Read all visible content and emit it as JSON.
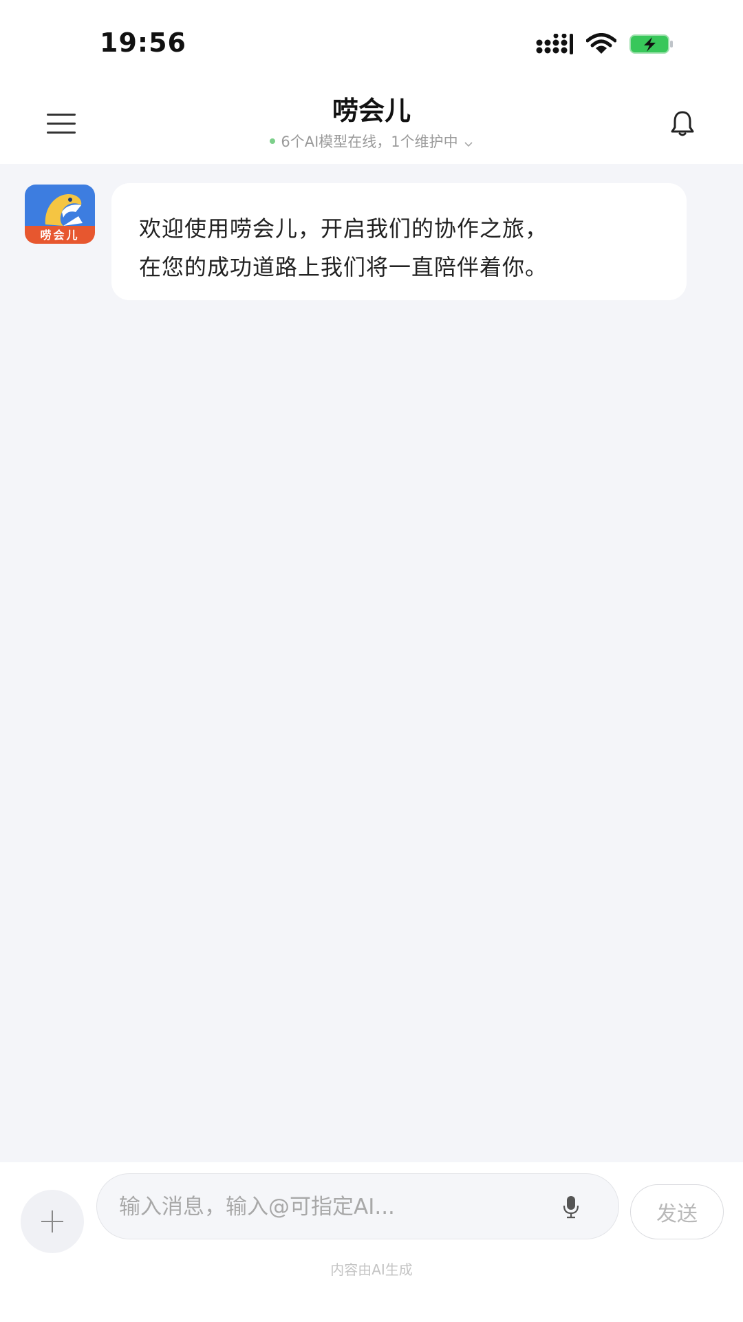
{
  "status_bar": {
    "time": "19:56"
  },
  "header": {
    "title": "唠会儿",
    "status_text": "6个AI模型在线，1个维护中",
    "menu_icon": "hamburger-menu-icon",
    "bell_icon": "bell-icon"
  },
  "chat": {
    "messages": [
      {
        "sender_avatar_label": "唠会儿",
        "lines": [
          "欢迎使用唠会儿，开启我们的协作之旅，",
          "在您的成功道路上我们将一直陪伴着你。"
        ]
      }
    ]
  },
  "input_bar": {
    "placeholder": "输入消息，输入@可指定AI...",
    "value": "",
    "send_label": "发送",
    "note": "内容由AI生成"
  },
  "colors": {
    "chat_background": "#f4f5f9",
    "online_dot": "#7ccf8a",
    "avatar_blue": "#3d7de0",
    "avatar_orange": "#e7572f",
    "battery_green": "#38c75a"
  }
}
